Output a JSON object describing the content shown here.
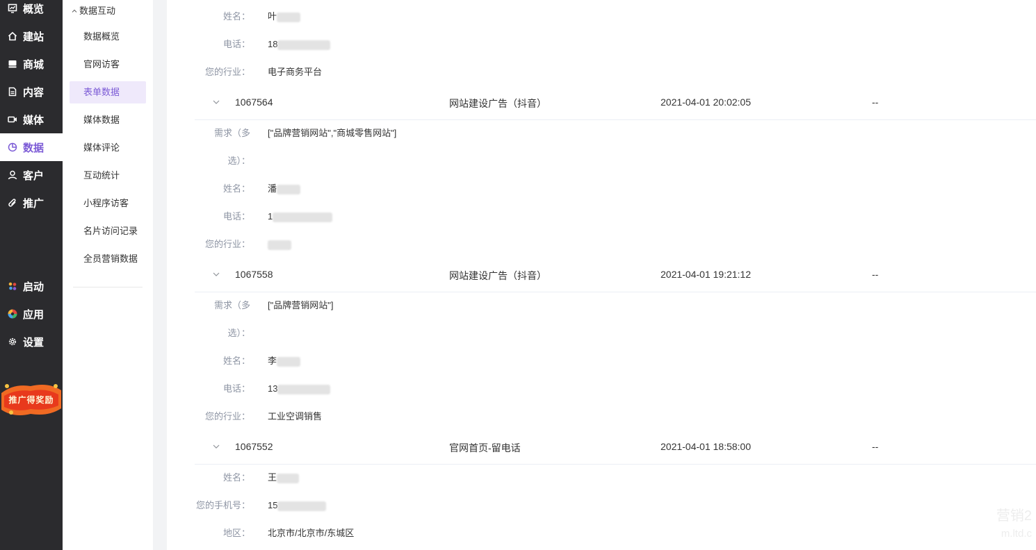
{
  "nav": {
    "items": [
      {
        "label": "概览",
        "icon": "chart-icon"
      },
      {
        "label": "建站",
        "icon": "home-icon"
      },
      {
        "label": "商城",
        "icon": "shop-icon"
      },
      {
        "label": "内容",
        "icon": "document-icon"
      },
      {
        "label": "媒体",
        "icon": "video-icon"
      },
      {
        "label": "数据",
        "icon": "pie-chart-icon"
      },
      {
        "label": "客户",
        "icon": "user-icon"
      },
      {
        "label": "推广",
        "icon": "paperclip-icon"
      }
    ],
    "bottom_items": [
      {
        "label": "启动",
        "icon": "launch-icon"
      },
      {
        "label": "应用",
        "icon": "apps-icon"
      },
      {
        "label": "设置",
        "icon": "gear-icon"
      }
    ],
    "promo_label": "推广得奖励",
    "accent": "#7c5bd6"
  },
  "sub_nav": {
    "header": "数据互动",
    "items": [
      "数据概览",
      "官网访客",
      "表单数据",
      "媒体数据",
      "媒体评论",
      "互动统计",
      "小程序访客",
      "名片访问记录",
      "全员营销数据"
    ],
    "active": "表单数据"
  },
  "main": {
    "top_details": [
      {
        "label": "姓名：",
        "value": "叶"
      },
      {
        "label": "电话：",
        "value": "18"
      },
      {
        "label": "您的行业：",
        "value": "电子商务平台"
      }
    ],
    "records": [
      {
        "id": "1067564",
        "source": "网站建设广告（抖音）",
        "time": "2021-04-01 20:02:05",
        "extra": "--",
        "details": [
          {
            "label": "需求（多",
            "value": "[\"品牌营销网站\",\"商城零售网站\"]"
          },
          {
            "label": "选）：",
            "value": ""
          },
          {
            "label": "姓名：",
            "value": "潘"
          },
          {
            "label": "电话：",
            "value": "1"
          },
          {
            "label": "您的行业：",
            "value": ""
          }
        ]
      },
      {
        "id": "1067558",
        "source": "网站建设广告（抖音）",
        "time": "2021-04-01 19:21:12",
        "extra": "--",
        "details": [
          {
            "label": "需求（多",
            "value": "[\"品牌营销网站\"]"
          },
          {
            "label": "选）：",
            "value": ""
          },
          {
            "label": "姓名：",
            "value": "李"
          },
          {
            "label": "电话：",
            "value": "13"
          },
          {
            "label": "您的行业：",
            "value": "工业空调销售"
          }
        ]
      },
      {
        "id": "1067552",
        "source": "官网首页-留电话",
        "time": "2021-04-01 18:58:00",
        "extra": "--",
        "details": [
          {
            "label": "姓名：",
            "value": "王"
          },
          {
            "label": "您的手机号：",
            "value": "15"
          },
          {
            "label": "地区：",
            "value": "北京市/北京市/东城区"
          }
        ]
      }
    ]
  },
  "watermark": [
    "营销2",
    "m.ltd.c"
  ]
}
